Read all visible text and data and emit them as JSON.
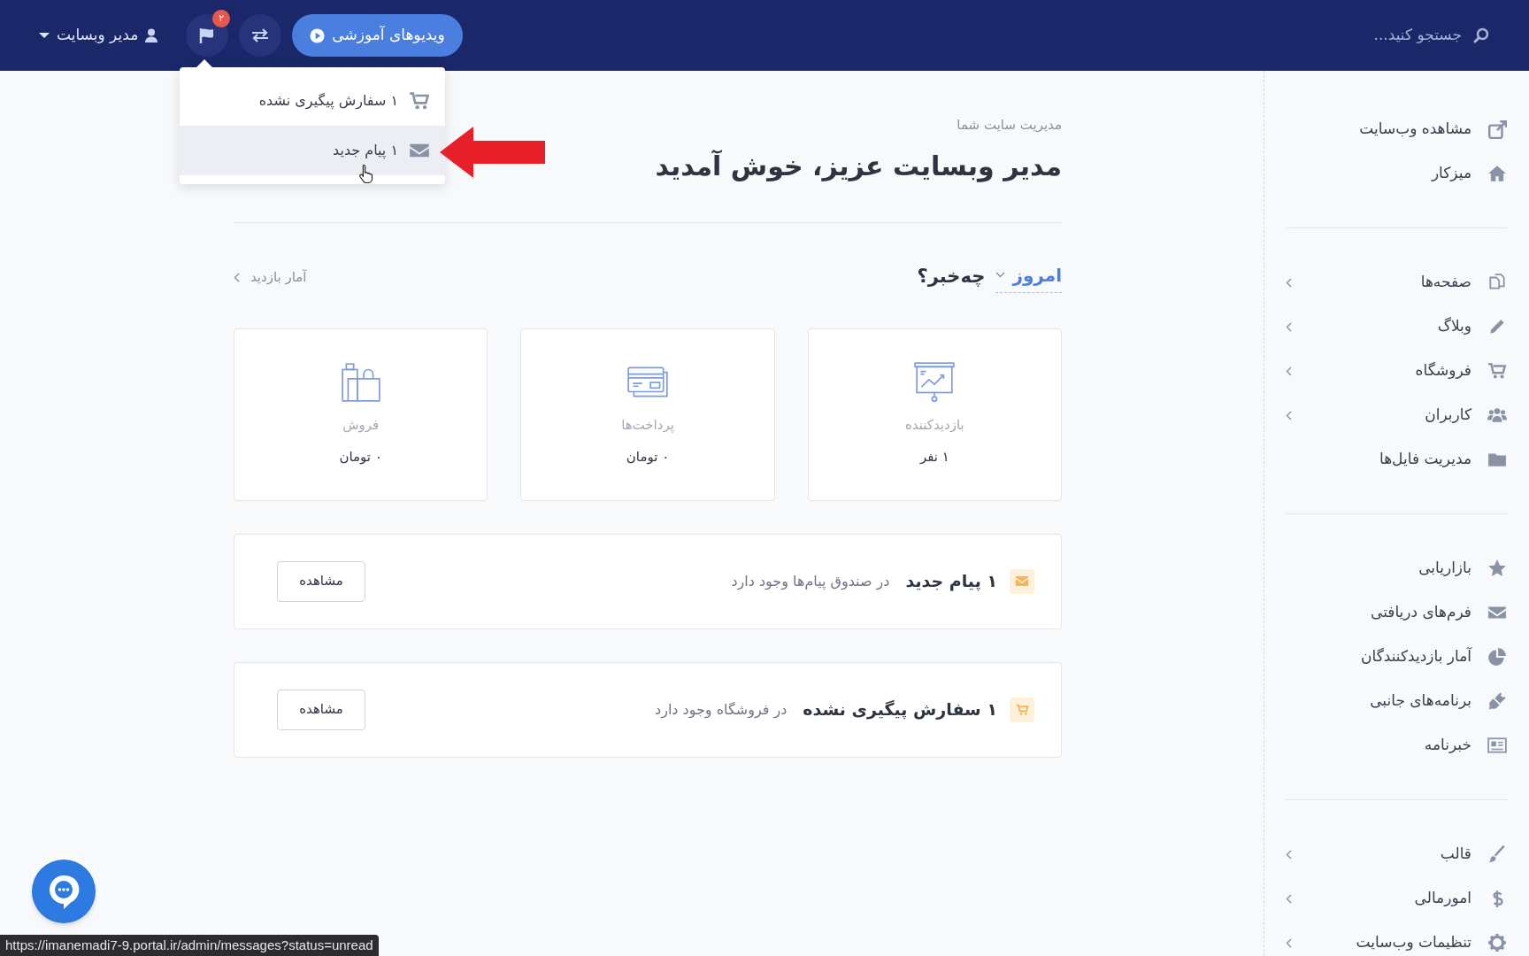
{
  "header": {
    "search": {
      "placeholder": "جستجو کنید..."
    },
    "videos_button": "ویدیوهای آموزشی",
    "notification_badge": "۲",
    "user_menu": "مدیر وبسایت"
  },
  "notifications_dropdown": [
    {
      "kind": "order",
      "label": "۱ سفارش پیگیری نشده",
      "selected": false
    },
    {
      "kind": "message",
      "label": "۱ پیام جدید",
      "selected": true
    }
  ],
  "page": {
    "subtitle": "مدیریت سایت شما",
    "title": "مدیر وبسایت عزیز، خوش آمدید"
  },
  "overview": {
    "period": "امروز",
    "heading": "چه‌خبر؟",
    "stats_link": "آمار بازدید"
  },
  "stat_cards": [
    {
      "kind": "visitors",
      "label": "بازدیدکننده",
      "value": "۱ نفر"
    },
    {
      "kind": "payments",
      "label": "پرداخت‌ها",
      "value": "۰ تومان"
    },
    {
      "kind": "sales",
      "label": "فروش",
      "value": "۰ تومان"
    }
  ],
  "alerts": [
    {
      "kind": "message",
      "title": "۱ پیام جدید",
      "detail": "در صندوق پیام‌ها وجود دارد",
      "button": "مشاهده"
    },
    {
      "kind": "order",
      "title": "۱ سفارش پیگیری نشده",
      "detail": "در فروشگاه وجود دارد",
      "button": "مشاهده"
    }
  ],
  "sidebar": {
    "groups": [
      [
        {
          "label": "مشاهده وب‌سایت",
          "expandable": false
        },
        {
          "label": "میزکار",
          "expandable": false
        }
      ],
      [
        {
          "label": "صفحه‌ها",
          "expandable": true
        },
        {
          "label": "وبلاگ",
          "expandable": true
        },
        {
          "label": "فروشگاه",
          "expandable": true
        },
        {
          "label": "کاربران",
          "expandable": true
        },
        {
          "label": "مدیریت فایل‌ها",
          "expandable": false
        }
      ],
      [
        {
          "label": "بازاریابی",
          "expandable": false
        },
        {
          "label": "فرم‌های دریافتی",
          "expandable": false
        },
        {
          "label": "آمار بازدیدکنندگان",
          "expandable": false
        },
        {
          "label": "برنامه‌های جانبی",
          "expandable": false
        },
        {
          "label": "خبرنامه",
          "expandable": false
        }
      ],
      [
        {
          "label": "قالب",
          "expandable": true
        },
        {
          "label": "امورمالی",
          "expandable": true
        },
        {
          "label": "تنظیمات وب‌سایت",
          "expandable": true
        }
      ]
    ]
  },
  "status_url": "https://imanemadi7-9.portal.ir/admin/messages?status=unread"
}
